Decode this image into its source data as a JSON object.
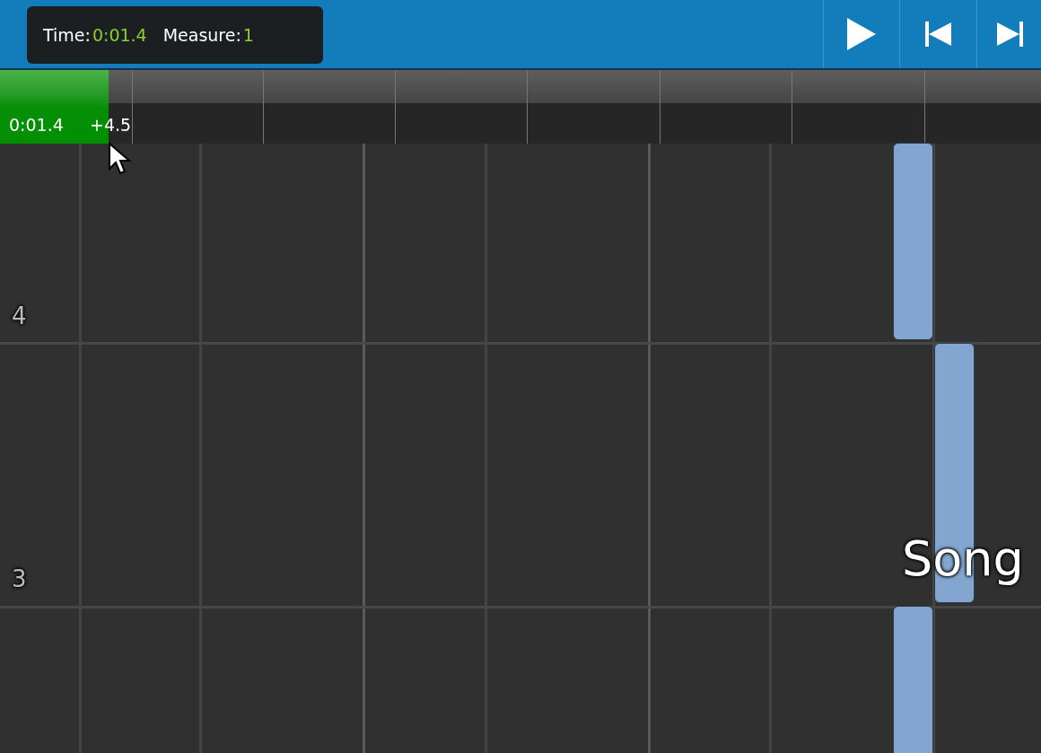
{
  "tooltip": {
    "time_label": "Time:",
    "time_value": "0:01.4",
    "measure_label": "Measure:",
    "measure_value": "1"
  },
  "transport": [
    {
      "kind": "play"
    },
    {
      "kind": "previous"
    },
    {
      "kind": "next"
    }
  ],
  "timeline": {
    "level": 0.104,
    "position": "0:01.4",
    "offset": "+4.5"
  },
  "rows": [
    {
      "label": "4"
    },
    {
      "label": "3"
    }
  ],
  "overlay_text": "Song"
}
